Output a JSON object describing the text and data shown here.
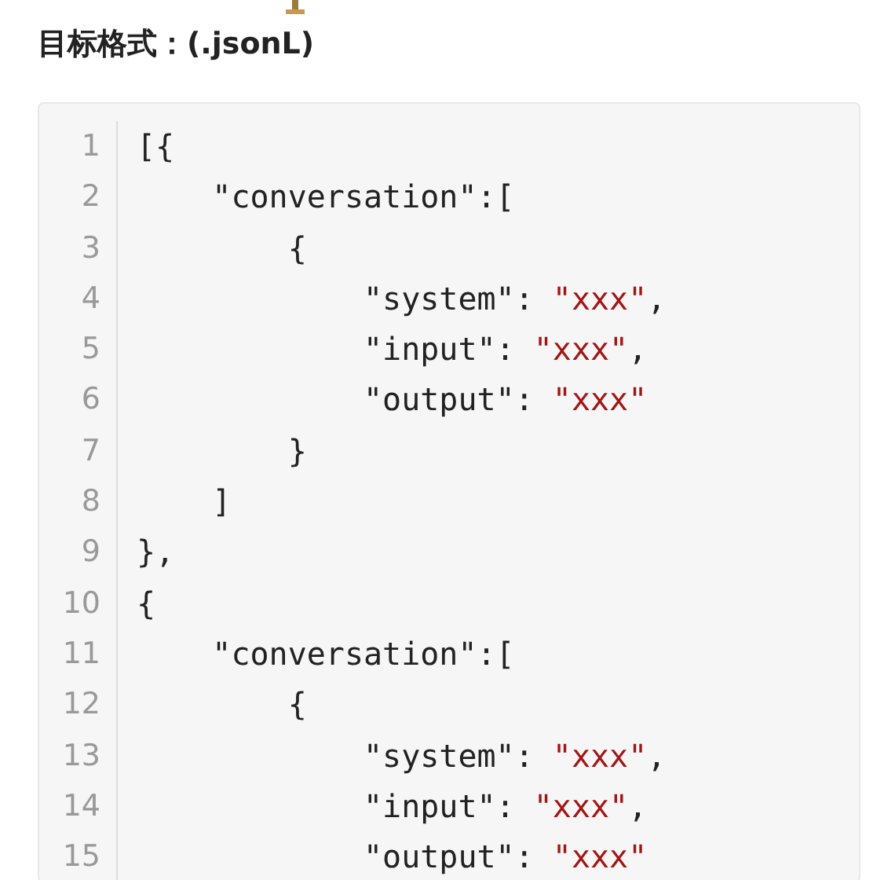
{
  "heading": "目标格式：(.jsonL)",
  "code": {
    "lines": [
      {
        "number": "1",
        "tokens": [
          {
            "kind": "plain",
            "text": "[{"
          }
        ]
      },
      {
        "number": "2",
        "tokens": [
          {
            "kind": "plain",
            "text": "    \"conversation\":["
          }
        ]
      },
      {
        "number": "3",
        "tokens": [
          {
            "kind": "plain",
            "text": "        {"
          }
        ]
      },
      {
        "number": "4",
        "tokens": [
          {
            "kind": "plain",
            "text": "            \"system\": "
          },
          {
            "kind": "string",
            "text": "\"xxx\""
          },
          {
            "kind": "plain",
            "text": ","
          }
        ]
      },
      {
        "number": "5",
        "tokens": [
          {
            "kind": "plain",
            "text": "            \"input\": "
          },
          {
            "kind": "string",
            "text": "\"xxx\""
          },
          {
            "kind": "plain",
            "text": ","
          }
        ]
      },
      {
        "number": "6",
        "tokens": [
          {
            "kind": "plain",
            "text": "            \"output\": "
          },
          {
            "kind": "string",
            "text": "\"xxx\""
          }
        ]
      },
      {
        "number": "7",
        "tokens": [
          {
            "kind": "plain",
            "text": "        }"
          }
        ]
      },
      {
        "number": "8",
        "tokens": [
          {
            "kind": "plain",
            "text": "    ]"
          }
        ]
      },
      {
        "number": "9",
        "tokens": [
          {
            "kind": "plain",
            "text": "},"
          }
        ]
      },
      {
        "number": "10",
        "tokens": [
          {
            "kind": "plain",
            "text": "{"
          }
        ]
      },
      {
        "number": "11",
        "tokens": [
          {
            "kind": "plain",
            "text": "    \"conversation\":["
          }
        ]
      },
      {
        "number": "12",
        "tokens": [
          {
            "kind": "plain",
            "text": "        {"
          }
        ]
      },
      {
        "number": "13",
        "tokens": [
          {
            "kind": "plain",
            "text": "            \"system\": "
          },
          {
            "kind": "string",
            "text": "\"xxx\""
          },
          {
            "kind": "plain",
            "text": ","
          }
        ]
      },
      {
        "number": "14",
        "tokens": [
          {
            "kind": "plain",
            "text": "            \"input\": "
          },
          {
            "kind": "string",
            "text": "\"xxx\""
          },
          {
            "kind": "plain",
            "text": ","
          }
        ]
      },
      {
        "number": "15",
        "tokens": [
          {
            "kind": "plain",
            "text": "            \"output\": "
          },
          {
            "kind": "string",
            "text": "\"xxx\""
          }
        ]
      }
    ]
  }
}
